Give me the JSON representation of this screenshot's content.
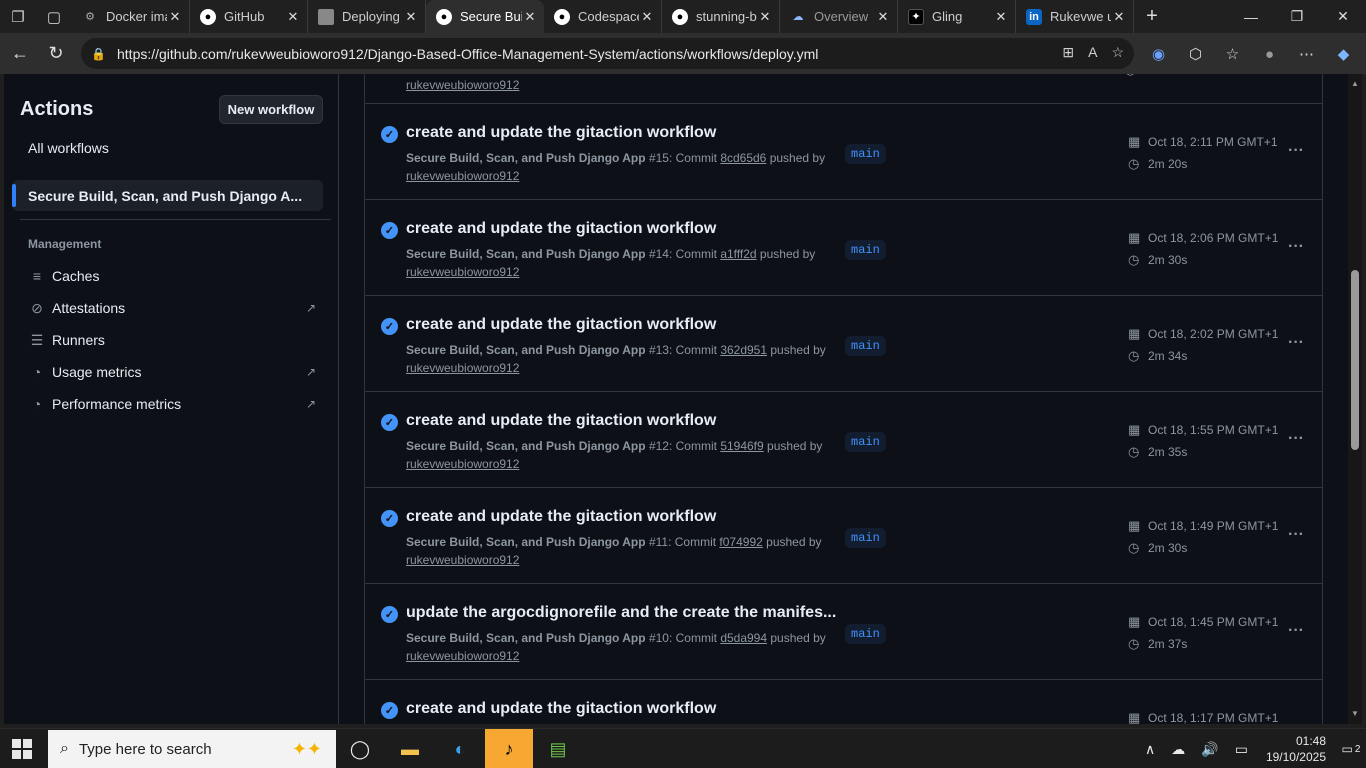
{
  "browser": {
    "tabs": [
      {
        "label": "Docker images",
        "icon": "gear-icon",
        "active": false
      },
      {
        "label": "GitHub",
        "icon": "github-icon",
        "active": false
      },
      {
        "label": "Deploying",
        "icon": "image-icon",
        "active": false
      },
      {
        "label": "Secure Build",
        "icon": "github-icon",
        "active": true
      },
      {
        "label": "Codespaces",
        "icon": "github-icon",
        "active": false
      },
      {
        "label": "stunning-bassoon",
        "icon": "github-icon",
        "active": false
      },
      {
        "label": "Overview",
        "icon": "cloud-icon",
        "active": false
      },
      {
        "label": "Gling",
        "icon": "gling-icon",
        "active": false
      },
      {
        "label": "Rukevwe u",
        "icon": "linkedin-icon",
        "active": false
      }
    ],
    "url": "https://github.com/rukevweubioworo912/Django-Based-Office-Management-System/actions/workflows/deploy.yml"
  },
  "sidebar": {
    "title": "Actions",
    "new_workflow_label": "New workflow",
    "all_workflows_label": "All workflows",
    "selected_workflow": "Secure Build, Scan, and Push Django A...",
    "management_heading": "Management",
    "items": [
      {
        "label": "Caches",
        "icon": "database-icon",
        "external": false
      },
      {
        "label": "Attestations",
        "icon": "check-circle-icon",
        "external": true
      },
      {
        "label": "Runners",
        "icon": "server-icon",
        "external": false
      },
      {
        "label": "Usage metrics",
        "icon": "gauge-icon",
        "external": true
      },
      {
        "label": "Performance metrics",
        "icon": "gauge-icon",
        "external": true
      }
    ]
  },
  "runs": {
    "partial_top_user": "rukevweubioworo912",
    "items": [
      {
        "title": "create and update the gitaction workflow",
        "workflow": "Secure Build, Scan, and Push Django App",
        "number": "#15",
        "commit_prefix": ": Commit",
        "commit": "8cd65d6",
        "pushed_by": "pushed by",
        "user": "rukevweubioworo912",
        "branch": "main",
        "date": "Oct 18, 2:11 PM GMT+1",
        "duration": "2m 20s"
      },
      {
        "title": "create and update the gitaction workflow",
        "workflow": "Secure Build, Scan, and Push Django App",
        "number": "#14",
        "commit_prefix": ": Commit",
        "commit": "a1fff2d",
        "pushed_by": "pushed by",
        "user": "rukevweubioworo912",
        "branch": "main",
        "date": "Oct 18, 2:06 PM GMT+1",
        "duration": "2m 30s"
      },
      {
        "title": "create and update the gitaction workflow",
        "workflow": "Secure Build, Scan, and Push Django App",
        "number": "#13",
        "commit_prefix": ": Commit",
        "commit": "362d951",
        "pushed_by": "pushed by",
        "user": "rukevweubioworo912",
        "branch": "main",
        "date": "Oct 18, 2:02 PM GMT+1",
        "duration": "2m 34s"
      },
      {
        "title": "create and update the gitaction workflow",
        "workflow": "Secure Build, Scan, and Push Django App",
        "number": "#12",
        "commit_prefix": ": Commit",
        "commit": "51946f9",
        "pushed_by": "pushed by",
        "user": "rukevweubioworo912",
        "branch": "main",
        "date": "Oct 18, 1:55 PM GMT+1",
        "duration": "2m 35s"
      },
      {
        "title": "create and update the gitaction workflow",
        "workflow": "Secure Build, Scan, and Push Django App",
        "number": "#11",
        "commit_prefix": ": Commit",
        "commit": "f074992",
        "pushed_by": "pushed by",
        "user": "rukevweubioworo912",
        "branch": "main",
        "date": "Oct 18, 1:49 PM GMT+1",
        "duration": "2m 30s"
      },
      {
        "title": "update the argocdignorefile and the create the manifes...",
        "workflow": "Secure Build, Scan, and Push Django App",
        "number": "#10",
        "commit_prefix": ": Commit",
        "commit": "d5da994",
        "pushed_by": "pushed by",
        "user": "rukevweubioworo912",
        "branch": "main",
        "date": "Oct 18, 1:45 PM GMT+1",
        "duration": "2m 37s"
      },
      {
        "title": "create and update the gitaction workflow",
        "workflow": "",
        "number": "",
        "commit_prefix": "",
        "commit": "",
        "pushed_by": "",
        "user": "",
        "branch": "",
        "date": "Oct 18, 1:17 PM GMT+1",
        "duration": ""
      }
    ]
  },
  "taskbar": {
    "search_placeholder": "Type here to search",
    "time": "01:48",
    "date": "19/10/2025",
    "notifications": "2"
  },
  "colors": {
    "page_bg": "#0d1117",
    "accent_blue": "#4493f8",
    "muted_text": "#8d96a0",
    "border": "#30363d"
  }
}
